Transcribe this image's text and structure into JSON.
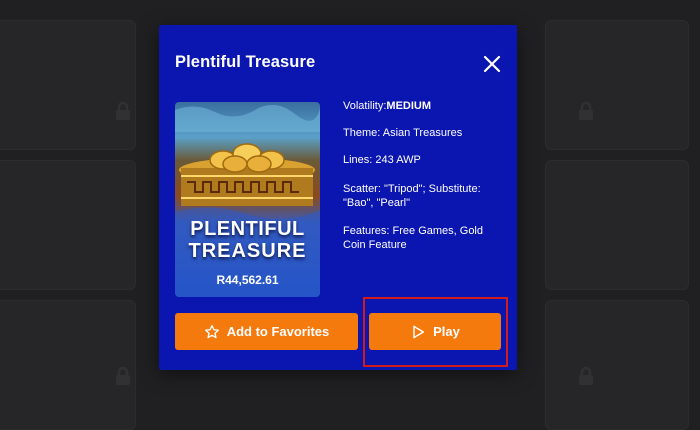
{
  "modal": {
    "title": "Plentiful Treasure",
    "close_icon": "close-icon"
  },
  "thumbnail": {
    "title_line1": "PLENTIFUL",
    "title_line2": "TREASURE",
    "jackpot": "R44,562.61"
  },
  "details": {
    "volatility_label": "Volatility:",
    "volatility_value": "MEDIUM",
    "theme": "Theme: Asian Treasures",
    "lines": "Lines: 243 AWP",
    "scatter_line1": "Scatter: \"Tripod\"; Substitute:",
    "scatter_line2": "\"Bao\", \"Pearl\"",
    "features_line1": "Features: Free Games, Gold",
    "features_line2": "Coin Feature"
  },
  "buttons": {
    "favorites_label": "Add to Favorites",
    "favorites_icon": "star-icon",
    "play_label": "Play",
    "play_icon": "play-icon"
  },
  "colors": {
    "modal_bg": "#0b16b0",
    "button_orange": "#f47a0e",
    "highlight_red": "#d01c1c",
    "page_bg": "#202022"
  }
}
